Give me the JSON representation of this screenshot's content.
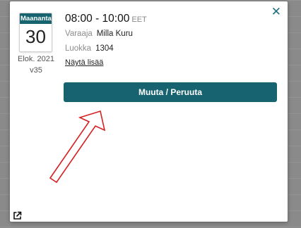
{
  "event": {
    "weekday": "Maanantaina",
    "day": "30",
    "month_year": "Elok. 2021",
    "week": "v35",
    "time_range": "08:00 - 10:00",
    "timezone": "EET",
    "booker_label": "Varaaja",
    "booker": "Milla Kuru",
    "room_label": "Luokka",
    "room": "1304",
    "more_link": "Näytä lisää"
  },
  "actions": {
    "modify_cancel": "Muuta / Peruuta"
  },
  "icons": {
    "close": "close-icon",
    "open_external": "external-link-icon"
  },
  "colors": {
    "accent": "#176470",
    "arrow": "#d42020"
  }
}
